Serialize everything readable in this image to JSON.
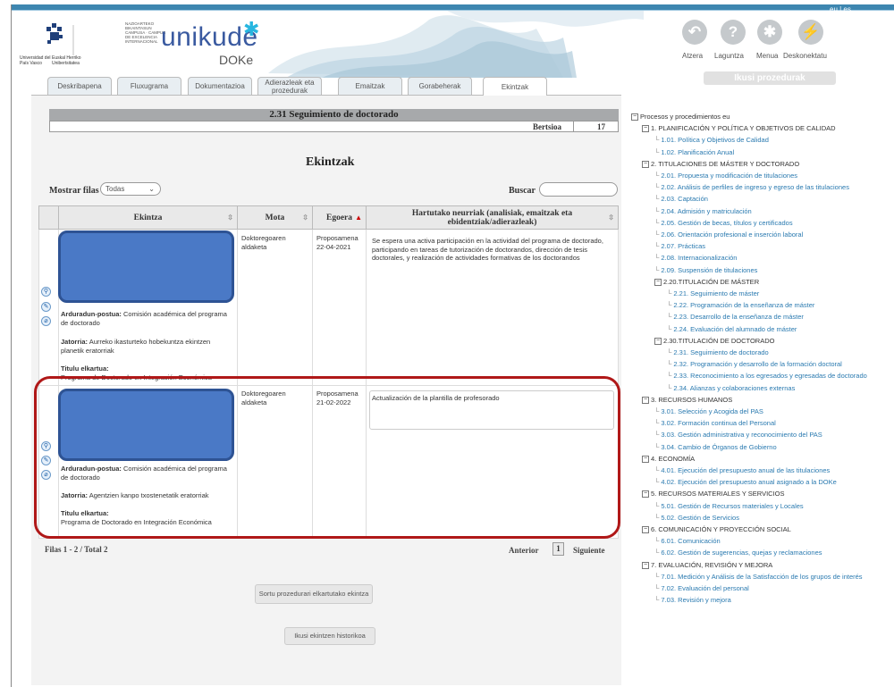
{
  "header": {
    "lang": "eu | es",
    "ehu_line1": "Universidad del País Vasco",
    "ehu_line2": "Euskal Herriko Unibertsitatea",
    "campus_text": "NAZIOARTEKO BIKAINTASUN CAMPUSA · CAMPUS DE EXCELENCIA INTERNACIONAL",
    "app_name": "unikude",
    "app_sub": "DOKe",
    "toolbar": [
      {
        "label": "Atzera",
        "icon": "back-arrow-icon",
        "glyph": "↶"
      },
      {
        "label": "Laguntza",
        "icon": "help-icon",
        "glyph": "?"
      },
      {
        "label": "Menua",
        "icon": "menu-asterisk-icon",
        "glyph": "✱"
      },
      {
        "label": "Deskonektatu",
        "icon": "disconnect-bolt-icon",
        "glyph": "⚡"
      }
    ],
    "ikusi_button": "Ikusi prozedurak"
  },
  "tabs": [
    "Deskribapena",
    "Fluxugrama",
    "Dokumentazioa",
    "Adierazleak eta prozedurak",
    "Emaitzak",
    "Gorabeherak",
    "Ekintzak"
  ],
  "active_tab": "Ekintzak",
  "record": {
    "title": "2.31 Seguimiento de doctorado",
    "version_label": "Bertsioa",
    "version": "17"
  },
  "section_title": "Ekintzak",
  "filters": {
    "show_label": "Mostrar filas",
    "show_value": "Todas",
    "search_label": "Buscar",
    "search_value": ""
  },
  "table": {
    "headers": [
      "Ekintza",
      "Mota",
      "Egoera",
      "Hartutako neurriak (analisiak, emaitzak eta ebidentziak/adierazleak)"
    ],
    "rows": [
      {
        "resp_label": "Arduradun-postua:",
        "resp": "Comisión académica del programa de doctorado",
        "origin_label": "Jatorria:",
        "origin": "Aurreko ikasturteko hobekuntza ekintzen planetik eratorriak",
        "title_label": "Titulu elkartua:",
        "title": "Programa de Doctorado en Integración Económica",
        "type": "Doktoregoaren aldaketa",
        "status": "Proposamena",
        "date": "22-04-2021",
        "measures": "Se espera una activa participación en la actividad del programa de doctorado, participando en tareas de tutorización de doctorandos, dirección de tesis doctorales, y realización de actividades formativas de los doctorandos"
      },
      {
        "resp_label": "Arduradun-postua:",
        "resp": "Comisión académica del programa de doctorado",
        "origin_label": "Jatorria:",
        "origin": "Agentzien kanpo txostenetatik eratorriak",
        "title_label": "Titulu elkartua:",
        "title": "Programa de Doctorado en Integración Económica",
        "type": "Doktoregoaren aldaketa",
        "status": "Proposamena",
        "date": "21-02-2022",
        "measures": "Actualización de la plantilla de profesorado"
      }
    ]
  },
  "pager": {
    "summary": "Filas 1 - 2 / Total 2",
    "prev": "Anterior",
    "page": "1",
    "next": "Siguiente"
  },
  "buttons": {
    "create": "Sortu prozedurari elkartutako ekintza",
    "history": "Ikusi ekintzen historikoa"
  },
  "tree": {
    "root": "Procesos y procedimientos eu",
    "nodes": [
      {
        "t": "1. PLANIFICACIÓN Y POLÍTICA Y OBJETIVOS DE CALIDAD",
        "lvl": 1,
        "kind": "hd"
      },
      {
        "t": "1.01. Política y Objetivos de Calidad",
        "lvl": 2,
        "kind": "lk"
      },
      {
        "t": "1.02. Planificación Anual",
        "lvl": 2,
        "kind": "lk"
      },
      {
        "t": "2. TITULACIONES DE MÁSTER Y DOCTORADO",
        "lvl": 1,
        "kind": "hd"
      },
      {
        "t": "2.01. Propuesta y modificación de titulaciones",
        "lvl": 2,
        "kind": "lk"
      },
      {
        "t": "2.02. Análisis de perfiles de ingreso y egreso de las titulaciones",
        "lvl": 2,
        "kind": "lk"
      },
      {
        "t": "2.03. Captación",
        "lvl": 2,
        "kind": "lk"
      },
      {
        "t": "2.04. Admisión y matriculación",
        "lvl": 2,
        "kind": "lk"
      },
      {
        "t": "2.05. Gestión de becas, títulos y certificados",
        "lvl": 2,
        "kind": "lk"
      },
      {
        "t": "2.06. Orientación profesional e inserción laboral",
        "lvl": 2,
        "kind": "lk"
      },
      {
        "t": "2.07. Prácticas",
        "lvl": 2,
        "kind": "lk"
      },
      {
        "t": "2.08. Internacionalización",
        "lvl": 2,
        "kind": "lk"
      },
      {
        "t": "2.09. Suspensión de titulaciones",
        "lvl": 2,
        "kind": "lk"
      },
      {
        "t": "2.20.TITULACIÓN DE MÁSTER",
        "lvl": 2,
        "kind": "hd"
      },
      {
        "t": "2.21. Seguimiento de máster",
        "lvl": 3,
        "kind": "lk"
      },
      {
        "t": "2.22. Programación de la enseñanza de máster",
        "lvl": 3,
        "kind": "lk"
      },
      {
        "t": "2.23. Desarrollo de la enseñanza de máster",
        "lvl": 3,
        "kind": "lk"
      },
      {
        "t": "2.24. Evaluación del alumnado de máster",
        "lvl": 3,
        "kind": "lk"
      },
      {
        "t": "2.30.TITULACIÓN DE DOCTORADO",
        "lvl": 2,
        "kind": "hd"
      },
      {
        "t": "2.31. Seguimiento de doctorado",
        "lvl": 3,
        "kind": "lk"
      },
      {
        "t": "2.32. Programación y desarrollo de la formación doctoral",
        "lvl": 3,
        "kind": "lk"
      },
      {
        "t": "2.33. Reconocimiento a los egresados y egresadas de doctorado",
        "lvl": 3,
        "kind": "lk"
      },
      {
        "t": "2.34. Alianzas y colaboraciones externas",
        "lvl": 3,
        "kind": "lk"
      },
      {
        "t": "3. RECURSOS HUMANOS",
        "lvl": 1,
        "kind": "hd"
      },
      {
        "t": "3.01. Selección y Acogida del PAS",
        "lvl": 2,
        "kind": "lk"
      },
      {
        "t": "3.02. Formación continua del Personal",
        "lvl": 2,
        "kind": "lk"
      },
      {
        "t": "3.03. Gestión administrativa y reconocimiento del PAS",
        "lvl": 2,
        "kind": "lk"
      },
      {
        "t": "3.04. Cambio de Órganos de Gobierno",
        "lvl": 2,
        "kind": "lk"
      },
      {
        "t": "4. ECONOMÍA",
        "lvl": 1,
        "kind": "hd"
      },
      {
        "t": "4.01. Ejecución del presupuesto anual de las titulaciones",
        "lvl": 2,
        "kind": "lk"
      },
      {
        "t": "4.02. Ejecución del presupuesto anual asignado a la DOKe",
        "lvl": 2,
        "kind": "lk"
      },
      {
        "t": "5. RECURSOS MATERIALES Y SERVICIOS",
        "lvl": 1,
        "kind": "hd"
      },
      {
        "t": "5.01. Gestión de Recursos materiales y Locales",
        "lvl": 2,
        "kind": "lk"
      },
      {
        "t": "5.02. Gestión de Servicios",
        "lvl": 2,
        "kind": "lk"
      },
      {
        "t": "6. COMUNICACIÓN Y PROYECCIÓN SOCIAL",
        "lvl": 1,
        "kind": "hd"
      },
      {
        "t": "6.01. Comunicación",
        "lvl": 2,
        "kind": "lk"
      },
      {
        "t": "6.02. Gestión de sugerencias, quejas y reclamaciones",
        "lvl": 2,
        "kind": "lk"
      },
      {
        "t": "7. EVALUACIÓN, REVISIÓN Y MEJORA",
        "lvl": 1,
        "kind": "hd"
      },
      {
        "t": "7.01. Medición y Análisis de la Satisfacción de los grupos de interés",
        "lvl": 2,
        "kind": "lk"
      },
      {
        "t": "7.02. Evaluación del personal",
        "lvl": 2,
        "kind": "lk"
      },
      {
        "t": "7.03. Revisión y mejora",
        "lvl": 2,
        "kind": "lk"
      }
    ]
  },
  "colors": {
    "accent": "#3d86b0",
    "link": "#2a7ab0",
    "highlight": "#b01818",
    "redaction": "#4a79c6"
  }
}
